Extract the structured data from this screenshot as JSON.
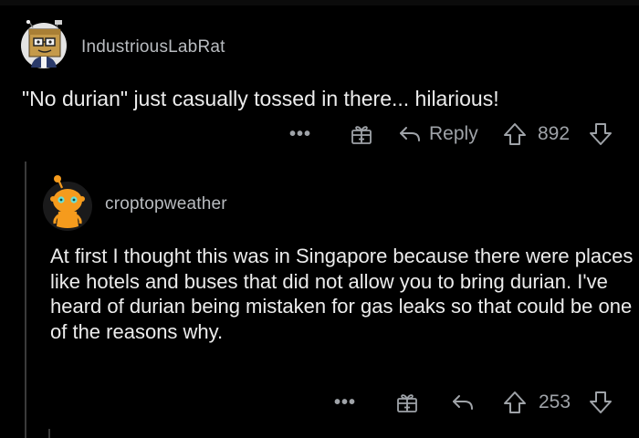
{
  "comments": [
    {
      "username": "IndustriousLabRat",
      "body": "\"No durian\" just casually tossed in there... hilarious!",
      "actions": {
        "more_label": "•••",
        "reply_label": "Reply",
        "score": "892"
      }
    },
    {
      "username": "croptopweather",
      "body": "At first I thought this was in Singapore because there were places like hotels and buses that did not allow you to bring durian. I've heard of durian being mistaken for gas leaks so that could be one of the reasons why.",
      "actions": {
        "more_label": "•••",
        "score": "253"
      }
    }
  ],
  "colors": {
    "background": "#000000",
    "text": "#ececec",
    "muted": "#9fa3a8",
    "avatar_orange": "#f59b1d",
    "avatar_teal": "#6be0d6"
  },
  "icons": [
    "award-gift-icon",
    "reply-arrow-icon",
    "upvote-arrow-icon",
    "downvote-arrow-icon",
    "more-options-icon"
  ]
}
